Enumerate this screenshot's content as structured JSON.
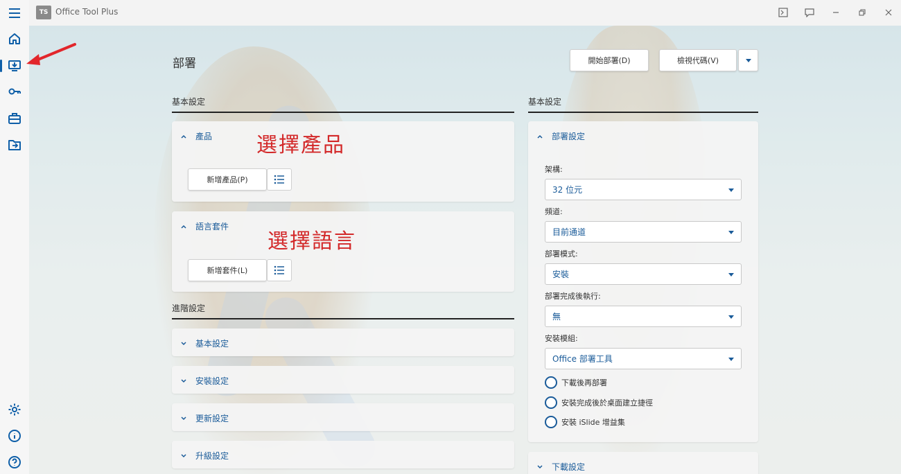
{
  "app": {
    "title": "Office Tool Plus",
    "logo_text": "TS"
  },
  "page": {
    "title": "部署"
  },
  "toolbar": {
    "deploy_label": "開始部署(D)",
    "view_code_label": "檢視代碼(V)"
  },
  "left": {
    "basic_header": "基本設定",
    "products": {
      "title": "產品",
      "add_label": "新增產品(P)",
      "note": "選擇產品"
    },
    "languages": {
      "title": "語言套件",
      "add_label": "新增套件(L)",
      "note": "選擇語言"
    },
    "advanced_header": "進階設定",
    "advanced_items": [
      "基本設定",
      "安裝設定",
      "更新設定",
      "升級設定"
    ]
  },
  "right": {
    "basic_header": "基本設定",
    "deploy_settings": {
      "title": "部署設定",
      "fields": [
        {
          "label": "架構:",
          "value": "32 位元"
        },
        {
          "label": "頻道:",
          "value": "目前通道"
        },
        {
          "label": "部署模式:",
          "value": "安裝"
        },
        {
          "label": "部署完成後執行:",
          "value": "無"
        },
        {
          "label": "安裝模組:",
          "value": "Office 部署工具"
        }
      ],
      "options": [
        "下載後再部署",
        "安裝完成後於桌面建立捷徑",
        "安裝 iSlide 增益集"
      ]
    },
    "download_settings": {
      "title": "下載設定"
    }
  },
  "colors": {
    "accent": "#1a5b99",
    "annotation": "#d3292a"
  }
}
